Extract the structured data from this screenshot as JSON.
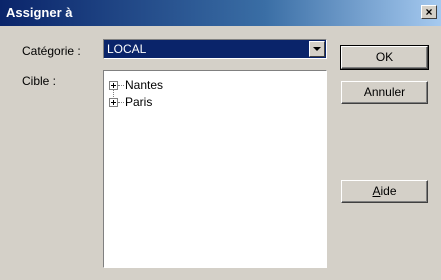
{
  "window": {
    "title": "Assigner à",
    "close_glyph": "×"
  },
  "form": {
    "category_label": "Catégorie :",
    "category_value": "LOCAL",
    "target_label": "Cible :"
  },
  "tree": {
    "items": [
      {
        "label": "Nantes"
      },
      {
        "label": "Paris"
      }
    ]
  },
  "buttons": {
    "ok": "OK",
    "cancel": "Annuler",
    "help_mnemonic": "A",
    "help_rest": "ide"
  }
}
